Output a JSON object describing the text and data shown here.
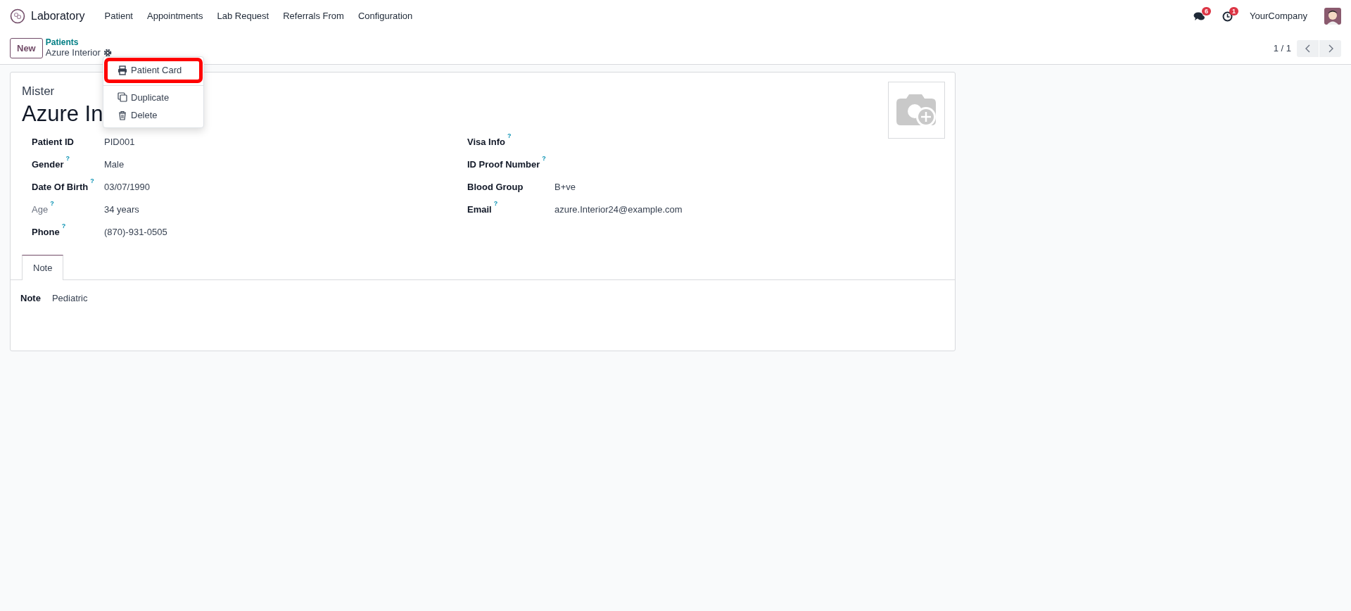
{
  "app": {
    "name": "Laboratory"
  },
  "menu": [
    {
      "label": "Patient"
    },
    {
      "label": "Appointments"
    },
    {
      "label": "Lab Request"
    },
    {
      "label": "Referrals From"
    },
    {
      "label": "Configuration"
    }
  ],
  "systray": {
    "messages_count": "6",
    "activities_count": "1",
    "company": "YourCompany"
  },
  "control_panel": {
    "new_button": "New",
    "breadcrumb": "Patients",
    "record": "Azure Interior",
    "pager": "1 / 1"
  },
  "action_menu": {
    "items": [
      {
        "label": "Patient Card",
        "kind": "print",
        "highlighted": true
      },
      {
        "label": "Duplicate",
        "kind": "duplicate",
        "highlighted": false
      },
      {
        "label": "Delete",
        "kind": "delete",
        "highlighted": false
      }
    ]
  },
  "form": {
    "title": "Mister",
    "name": "Azure In",
    "left_fields": [
      {
        "label": "Patient ID",
        "help": false,
        "muted": false,
        "value": "PID001"
      },
      {
        "label": "Gender",
        "help": true,
        "muted": false,
        "value": "Male"
      },
      {
        "label": "Date Of Birth",
        "help": true,
        "muted": false,
        "value": "03/07/1990"
      },
      {
        "label": "Age",
        "help": true,
        "muted": true,
        "value": "34 years"
      },
      {
        "label": "Phone",
        "help": true,
        "muted": false,
        "value": "(870)-931-0505"
      }
    ],
    "right_fields": [
      {
        "label": "Visa Info",
        "help": true,
        "muted": false
      },
      {
        "label": "ID Proof Number",
        "help": true,
        "muted": false
      },
      {
        "label": "Blood Group",
        "help": false,
        "muted": false,
        "value": "B+ve"
      },
      {
        "label": "Email",
        "help": true,
        "muted": false,
        "value": "azure.Interior24@example.com"
      }
    ],
    "help_mark": "?",
    "tabs": [
      {
        "label": "Note",
        "selected": true
      }
    ],
    "note": {
      "label": "Note",
      "value": "Pediatric"
    }
  }
}
